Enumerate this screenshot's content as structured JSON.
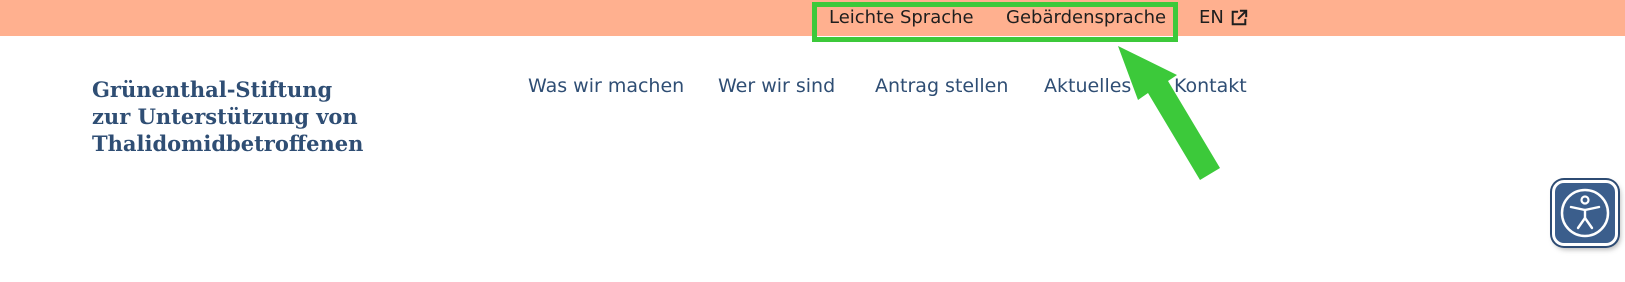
{
  "topbar": {
    "leichte_sprache": "Leichte Sprache",
    "gebaerdensprache": "Gebärdensprache",
    "language": "EN",
    "language_icon": "external-link-icon",
    "background": "#ffb08f"
  },
  "brand": {
    "line1": "Grünenthal-Stiftung",
    "line2": "zur Unterstützung von",
    "line3": "Thalidomidbetroffenen"
  },
  "nav": {
    "items": [
      {
        "label": "Was wir machen"
      },
      {
        "label": "Wer wir sind"
      },
      {
        "label": "Antrag stellen"
      },
      {
        "label": "Aktuelles"
      },
      {
        "label": "Kontakt"
      }
    ]
  },
  "annotation": {
    "highlight_color": "#3cc93a",
    "arrow_icon": "green-arrow-icon"
  },
  "accessibility": {
    "icon": "accessibility-person-icon",
    "color": "#3b5e8c"
  }
}
